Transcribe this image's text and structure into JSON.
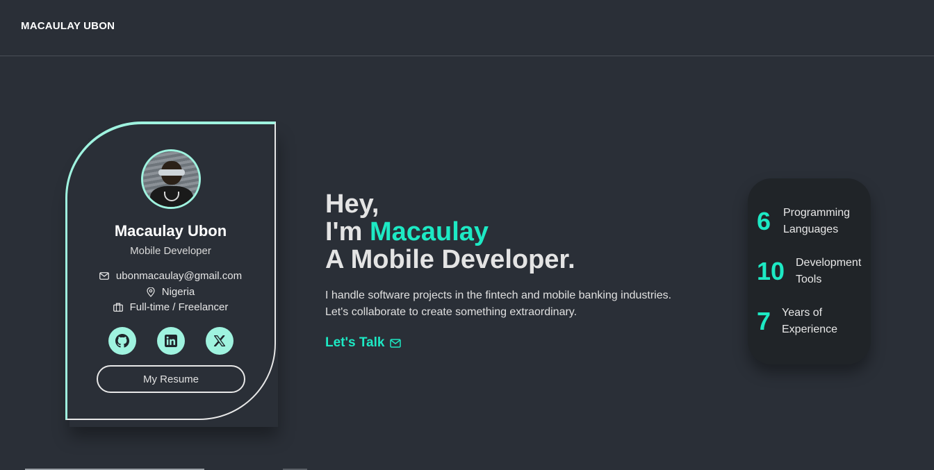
{
  "header": {
    "brand": "MACAULAY UBON"
  },
  "profile": {
    "name": "Macaulay Ubon",
    "role": "Mobile Developer",
    "email": "ubonmacaulay@gmail.com",
    "location": "Nigeria",
    "availability": "Full-time / Freelancer",
    "socials": [
      {
        "icon": "github-icon"
      },
      {
        "icon": "linkedin-icon"
      },
      {
        "icon": "x-twitter-icon"
      }
    ],
    "resume_label": "My Resume"
  },
  "hero": {
    "line1": "Hey,",
    "line2_prefix": "I'm ",
    "line2_name": "Macaulay",
    "line3": "A Mobile Developer.",
    "desc_line1": "I handle software projects in the fintech and mobile banking industries.",
    "desc_line2": "Let's collaborate to create something extraordinary.",
    "cta_label": "Let's Talk"
  },
  "stats": [
    {
      "number": "6",
      "label_line1": "Programming",
      "label_line2": "Languages"
    },
    {
      "number": "10",
      "label_line1": "Development",
      "label_line2": "Tools"
    },
    {
      "number": "7",
      "label_line1": "Years of",
      "label_line2": "Experience"
    }
  ],
  "colors": {
    "background": "#2a2f37",
    "accent": "#1de9c4",
    "accent_soft": "#9ff3df",
    "stats_card": "#202428"
  }
}
